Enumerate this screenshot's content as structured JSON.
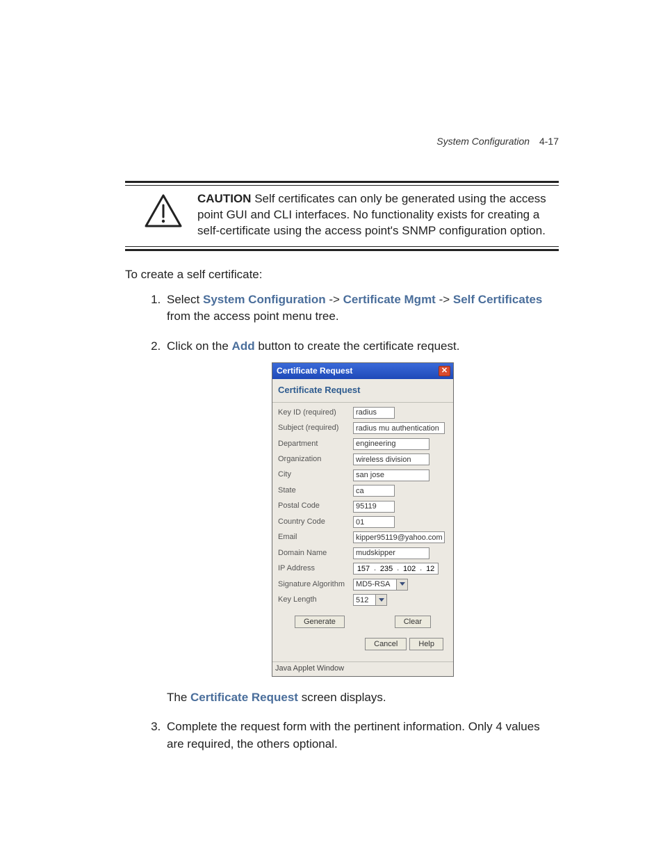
{
  "header": {
    "section_title": "System Configuration",
    "page_number": "4-17"
  },
  "caution": {
    "label": "CAUTION",
    "text": "Self certificates can only be generated using the access point GUI and CLI interfaces. No functionality exists for creating a self-certificate using the access point's SNMP configuration option."
  },
  "intro": "To create a self certificate:",
  "steps": {
    "s1_a": "Select ",
    "s1_kw1": "System Configuration",
    "s1_arrow": " -> ",
    "s1_kw2": "Certificate Mgmt",
    "s1_kw3": "Self Certificates",
    "s1_b": " from the access point menu tree.",
    "s2_a": "Click on the ",
    "s2_kw": "Add",
    "s2_b": " button to create the certificate request.",
    "after_a": "The ",
    "after_kw": "Certificate Request",
    "after_b": " screen displays.",
    "s3": "Complete the request form with the pertinent information. Only 4 values are required, the others optional."
  },
  "dialog": {
    "title": "Certificate Request",
    "section": "Certificate Request",
    "labels": {
      "key_id": "Key ID (required)",
      "subject": "Subject (required)",
      "department": "Department",
      "organization": "Organization",
      "city": "City",
      "state": "State",
      "postal": "Postal Code",
      "country": "Country Code",
      "email": "Email",
      "domain": "Domain Name",
      "ip": "IP Address",
      "sigalg": "Signature Algorithm",
      "keylen": "Key Length"
    },
    "values": {
      "key_id": "radius",
      "subject": "radius mu authentication",
      "department": "engineering",
      "organization": "wireless division",
      "city": "san jose",
      "state": "ca",
      "postal": "95119",
      "country": "01",
      "email": "kipper95119@yahoo.com",
      "domain": "mudskipper",
      "ip1": "157",
      "ip2": "235",
      "ip3": "102",
      "ip4": "12",
      "sigalg": "MD5-RSA",
      "keylen": "512"
    },
    "buttons": {
      "generate": "Generate",
      "clear": "Clear",
      "cancel": "Cancel",
      "help": "Help"
    },
    "status": "Java Applet Window"
  }
}
